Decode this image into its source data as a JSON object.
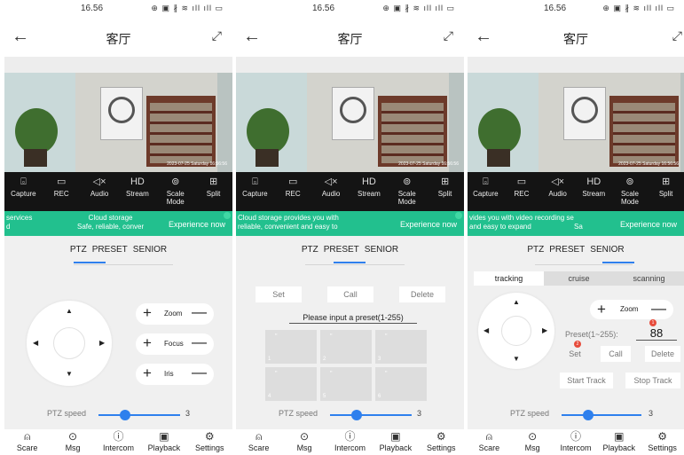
{
  "screens": [
    {
      "status": {
        "time": "16.56",
        "icons": "⊕ ▣ ∦ ≋ ıll ıll ▭"
      },
      "topbar": {
        "back": "←",
        "title": "客厅",
        "fullscreen": "⤢"
      },
      "video": {
        "timestamp": "2023-07-25 Saturday 16:56:56"
      },
      "toolbar": [
        {
          "icon": "⌻",
          "label": "Capture"
        },
        {
          "icon": "▭",
          "label": "REC"
        },
        {
          "icon": "◁×",
          "label": "Audio"
        },
        {
          "icon": "HD",
          "label": "Stream"
        },
        {
          "icon": "⊚",
          "label": "Scale Mode"
        },
        {
          "icon": "⊞",
          "label": "Split"
        }
      ],
      "banner": {
        "left_line1": "services",
        "left_line2": "d",
        "right_line1": "Cloud storage",
        "right_line2": "Safe, reliable, conver",
        "action": "Experience now"
      },
      "tabs": {
        "ptz": "PTZ",
        "preset": "PRESET",
        "senior": "SENIOR"
      },
      "controls": [
        {
          "plus": "+",
          "label": "Zoom",
          "minus": "—"
        },
        {
          "plus": "+",
          "label": "Focus",
          "minus": "—"
        },
        {
          "plus": "+",
          "label": "Iris",
          "minus": "—"
        }
      ],
      "dpad": {
        "up": "▲",
        "down": "▼",
        "left": "◀",
        "right": "▶"
      },
      "speed": {
        "label": "PTZ speed",
        "value": "3",
        "level": 0.33
      },
      "nav": [
        {
          "icon": "⍝",
          "label": "Scare"
        },
        {
          "icon": "⊙",
          "label": "Msg"
        },
        {
          "icon": "ⓘ",
          "label": "Intercom"
        },
        {
          "icon": "▣",
          "label": "Playback"
        },
        {
          "icon": "⚙",
          "label": "Settings"
        }
      ]
    },
    {
      "status": {
        "time": "16.56",
        "icons": "⊕ ▣ ∦ ≋ ıll ıll ▭"
      },
      "topbar": {
        "back": "←",
        "title": "客厅",
        "fullscreen": "⤢"
      },
      "video": {
        "timestamp": "2023-07-25 Saturday 16:56:56"
      },
      "toolbar": [
        {
          "icon": "⌻",
          "label": "Capture"
        },
        {
          "icon": "▭",
          "label": "REC"
        },
        {
          "icon": "◁×",
          "label": "Audio"
        },
        {
          "icon": "HD",
          "label": "Stream"
        },
        {
          "icon": "⊚",
          "label": "Scale Mode"
        },
        {
          "icon": "⊞",
          "label": "Split"
        }
      ],
      "banner": {
        "line1": "Cloud storage provides you with",
        "line2": "reliable, convenient and easy to",
        "action": "Experience now"
      },
      "tabs": {
        "ptz": "PTZ",
        "preset": "PRESET",
        "senior": "SENIOR"
      },
      "preset_buttons": {
        "set": "Set",
        "call": "Call",
        "delete": "Delete"
      },
      "preset_input": {
        "placeholder": "Please input a preset(1-255)"
      },
      "preset_cells": [
        {
          "tick": "\"",
          "num": "1"
        },
        {
          "tick": "\"",
          "num": "2"
        },
        {
          "tick": "\"",
          "num": "3"
        },
        {
          "tick": "\"",
          "num": "4"
        },
        {
          "tick": "\"",
          "num": "5"
        },
        {
          "tick": "\"",
          "num": "6"
        }
      ],
      "speed": {
        "label": "PTZ speed",
        "value": "3",
        "level": 0.33
      },
      "nav": [
        {
          "icon": "⍝",
          "label": "Scare"
        },
        {
          "icon": "⊙",
          "label": "Msg"
        },
        {
          "icon": "ⓘ",
          "label": "Intercom"
        },
        {
          "icon": "▣",
          "label": "Playback"
        },
        {
          "icon": "⚙",
          "label": "Settings"
        }
      ]
    },
    {
      "status": {
        "time": "16.56",
        "icons": "⊕ ▣ ∦ ≋ ıll ıll ▭"
      },
      "topbar": {
        "back": "←",
        "title": "客厅",
        "fullscreen": "⤢"
      },
      "video": {
        "timestamp": "2023-07-25 Saturday 16:56:56"
      },
      "toolbar": [
        {
          "icon": "⌻",
          "label": "Capture"
        },
        {
          "icon": "▭",
          "label": "REC"
        },
        {
          "icon": "◁×",
          "label": "Audio"
        },
        {
          "icon": "HD",
          "label": "Stream"
        },
        {
          "icon": "⊚",
          "label": "Scale Mode"
        },
        {
          "icon": "⊞",
          "label": "Split"
        }
      ],
      "banner": {
        "left_line1": "vides you with video recording se",
        "left_line2": "and easy to expand",
        "right_line2": "Sa",
        "action": "Experience now"
      },
      "tabs": {
        "ptz": "PTZ",
        "preset": "PRESET",
        "senior": "SENIOR"
      },
      "subtabs": {
        "tracking": "tracking",
        "cruise": "cruise",
        "scanning": "scanning"
      },
      "zoom": {
        "plus": "+",
        "label": "Zoom",
        "minus": "—"
      },
      "preset": {
        "label": "Preset(1~255):",
        "value": "88"
      },
      "preset_buttons": {
        "set": "Set",
        "call": "Call",
        "delete": "Delete"
      },
      "track_buttons": {
        "start": "Start Track",
        "stop": "Stop Track"
      },
      "badges": {
        "top": "1",
        "bottom": "2"
      },
      "dpad": {
        "up": "▲",
        "down": "▼",
        "left": "◀",
        "right": "▶"
      },
      "speed": {
        "label": "PTZ speed",
        "value": "3",
        "level": 0.33
      },
      "nav": [
        {
          "icon": "⍝",
          "label": "Scare"
        },
        {
          "icon": "⊙",
          "label": "Msg"
        },
        {
          "icon": "ⓘ",
          "label": "Intercom"
        },
        {
          "icon": "▣",
          "label": "Playback"
        },
        {
          "icon": "⚙",
          "label": "Settings"
        }
      ]
    }
  ],
  "colors": {
    "accent": "#2f80ed",
    "banner": "#22c08e",
    "toolbar": "#141414",
    "background": "#f0f0f0"
  }
}
